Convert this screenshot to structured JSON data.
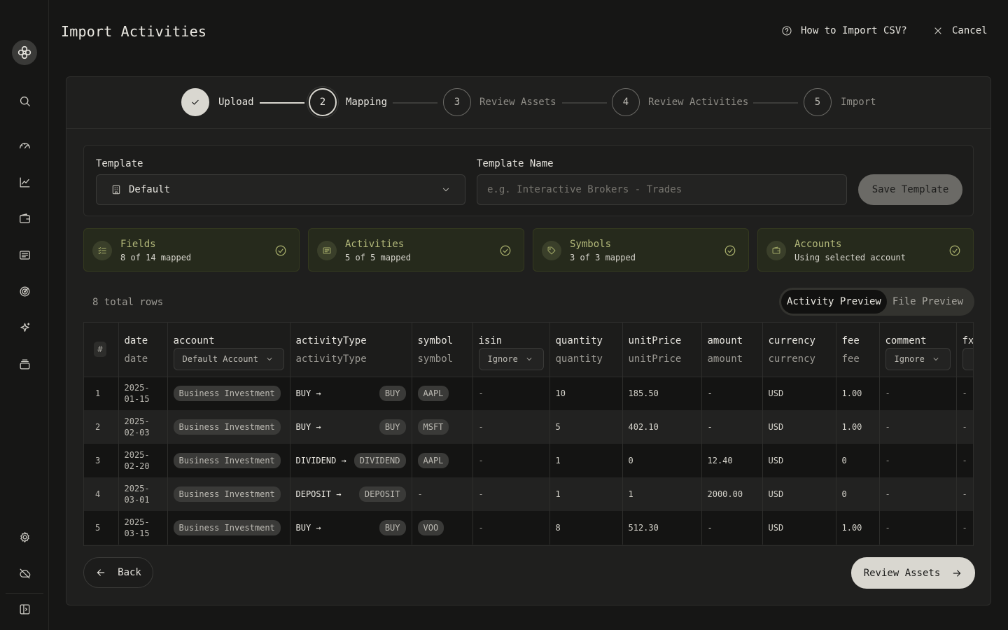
{
  "header": {
    "title": "Import Activities",
    "help_link": "How to Import CSV?",
    "cancel": "Cancel"
  },
  "sidebar": {
    "items": [
      {
        "icon": "search-icon"
      },
      {
        "icon": "dashboard-gauge-icon"
      },
      {
        "icon": "chart-line-icon"
      },
      {
        "icon": "wallet-icon"
      },
      {
        "icon": "activity-list-icon"
      },
      {
        "icon": "target-icon"
      },
      {
        "icon": "sparkle-icon"
      },
      {
        "icon": "stack-icon"
      },
      {
        "icon": "gear-icon"
      },
      {
        "icon": "cloud-off-icon"
      },
      {
        "icon": "sidebar-toggle-icon"
      }
    ]
  },
  "stepper": {
    "steps": [
      {
        "num": "",
        "label": "Upload",
        "state": "done"
      },
      {
        "num": "2",
        "label": "Mapping",
        "state": "active"
      },
      {
        "num": "3",
        "label": "Review Assets",
        "state": "pending"
      },
      {
        "num": "4",
        "label": "Review Activities",
        "state": "pending"
      },
      {
        "num": "5",
        "label": "Import",
        "state": "pending"
      }
    ]
  },
  "template": {
    "label": "Template",
    "selected": "Default",
    "name_label": "Template Name",
    "name_placeholder": "e.g. Interactive Brokers - Trades",
    "name_value": "",
    "save_label": "Save Template"
  },
  "summary": [
    {
      "title": "Fields",
      "subtitle": "8 of 14 mapped",
      "icon": "checklist-icon"
    },
    {
      "title": "Activities",
      "subtitle": "5 of 5 mapped",
      "icon": "receipt-icon"
    },
    {
      "title": "Symbols",
      "subtitle": "3 of 3 mapped",
      "icon": "tag-icon"
    },
    {
      "title": "Accounts",
      "subtitle": "Using selected account",
      "icon": "wallet-icon"
    }
  ],
  "preview": {
    "rows_text": "8 total rows",
    "tab_activity": "Activity Preview",
    "tab_file": "File Preview"
  },
  "table": {
    "hash": "#",
    "columns": {
      "date": {
        "name": "date",
        "mapped": "date"
      },
      "account": {
        "name": "account",
        "select": "Default Account"
      },
      "activityType": {
        "name": "activityType",
        "mapped": "activityType"
      },
      "symbol": {
        "name": "symbol",
        "mapped": "symbol"
      },
      "isin": {
        "name": "isin",
        "select": "Ignore"
      },
      "quantity": {
        "name": "quantity",
        "mapped": "quantity"
      },
      "unitPrice": {
        "name": "unitPrice",
        "mapped": "unitPrice"
      },
      "amount": {
        "name": "amount",
        "mapped": "amount"
      },
      "currency": {
        "name": "currency",
        "mapped": "currency"
      },
      "fee": {
        "name": "fee",
        "mapped": "fee"
      },
      "comment": {
        "name": "comment",
        "select": "Ignore"
      },
      "fx": {
        "name": "fx"
      }
    },
    "rows": [
      {
        "n": "1",
        "date": "2025-01-15",
        "account": "Business Investment",
        "act": "BUY →",
        "act_tag": "BUY",
        "symbol": "AAPL",
        "isin": "-",
        "quantity": "10",
        "unitPrice": "185.50",
        "amount": "-",
        "currency": "USD",
        "fee": "1.00",
        "comment": "-",
        "fx": "-"
      },
      {
        "n": "2",
        "date": "2025-02-03",
        "account": "Business Investment",
        "act": "BUY →",
        "act_tag": "BUY",
        "symbol": "MSFT",
        "isin": "-",
        "quantity": "5",
        "unitPrice": "402.10",
        "amount": "-",
        "currency": "USD",
        "fee": "1.00",
        "comment": "-",
        "fx": "-"
      },
      {
        "n": "3",
        "date": "2025-02-20",
        "account": "Business Investment",
        "act": "DIVIDEND →",
        "act_tag": "DIVIDEND",
        "symbol": "AAPL",
        "isin": "-",
        "quantity": "1",
        "unitPrice": "0",
        "amount": "12.40",
        "currency": "USD",
        "fee": "0",
        "comment": "-",
        "fx": "-"
      },
      {
        "n": "4",
        "date": "2025-03-01",
        "account": "Business Investment",
        "act": "DEPOSIT →",
        "act_tag": "DEPOSIT",
        "symbol": "-",
        "isin": "-",
        "quantity": "1",
        "unitPrice": "1",
        "amount": "2000.00",
        "currency": "USD",
        "fee": "0",
        "comment": "-",
        "fx": "-"
      },
      {
        "n": "5",
        "date": "2025-03-15",
        "account": "Business Investment",
        "act": "BUY →",
        "act_tag": "BUY",
        "symbol": "VOO",
        "isin": "-",
        "quantity": "8",
        "unitPrice": "512.30",
        "amount": "-",
        "currency": "USD",
        "fee": "1.00",
        "comment": "-",
        "fx": "-"
      }
    ]
  },
  "footer": {
    "back": "Back",
    "next": "Review Assets"
  }
}
